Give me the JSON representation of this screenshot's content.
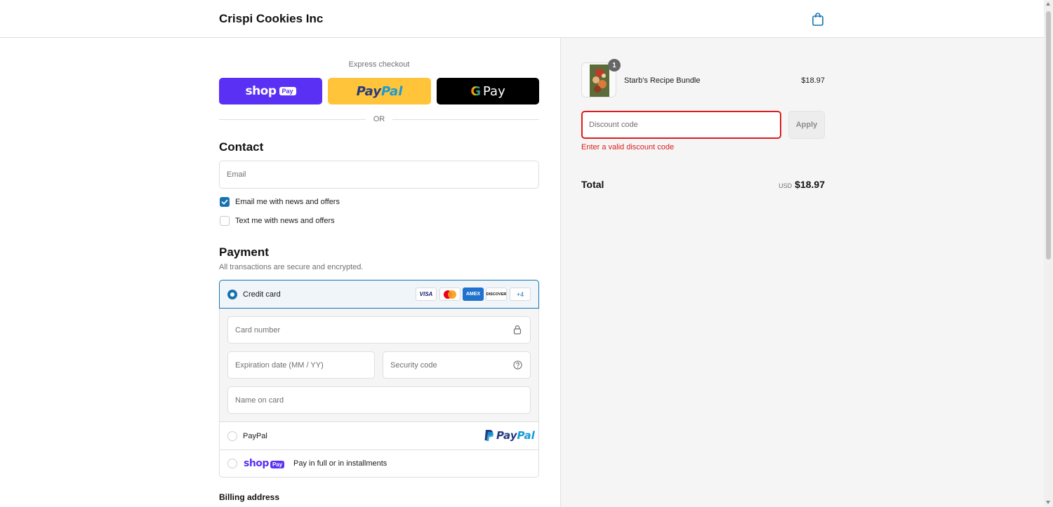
{
  "header": {
    "brand": "Crispi Cookies Inc",
    "cart_icon": "shopping-bag-icon"
  },
  "express": {
    "label": "Express checkout",
    "shop_pay": {
      "word": "shop",
      "chip": "Pay"
    },
    "paypal": {
      "part1": "Pay",
      "part2": "Pal"
    },
    "gpay": {
      "g": "G",
      "word": "Pay"
    },
    "separator": "OR"
  },
  "contact": {
    "heading": "Contact",
    "email_placeholder": "Email",
    "email_news_label": "Email me with news and offers",
    "email_news_checked": true,
    "text_news_label": "Text me with news and offers",
    "text_news_checked": false
  },
  "payment": {
    "heading": "Payment",
    "subtitle": "All transactions are secure and encrypted.",
    "credit_card_label": "Credit card",
    "card_brands": [
      "VISA",
      "MC",
      "AMEX",
      "DISCOVER"
    ],
    "more_brands": "+4",
    "card_number_placeholder": "Card number",
    "expiration_placeholder": "Expiration date (MM / YY)",
    "security_code_placeholder": "Security code",
    "name_on_card_placeholder": "Name on card",
    "paypal_label": "PayPal",
    "paypal_logo": {
      "part1": "Pay",
      "part2": "Pal"
    },
    "shoppay_word": "shop",
    "shoppay_chip": "Pay",
    "shoppay_label": "Pay in full or in installments"
  },
  "billing": {
    "heading": "Billing address"
  },
  "summary": {
    "item_name": "Starb's Recipe Bundle",
    "item_price": "$18.97",
    "item_qty": "1",
    "discount_placeholder": "Discount code",
    "apply_label": "Apply",
    "error": "Enter a valid discount code",
    "total_label": "Total",
    "currency": "USD",
    "total_amount": "$18.97"
  },
  "colors": {
    "shop_pay": "#5a31f4",
    "paypal": "#ffc439",
    "accent": "#1773b0",
    "error": "#dd1d1d"
  }
}
